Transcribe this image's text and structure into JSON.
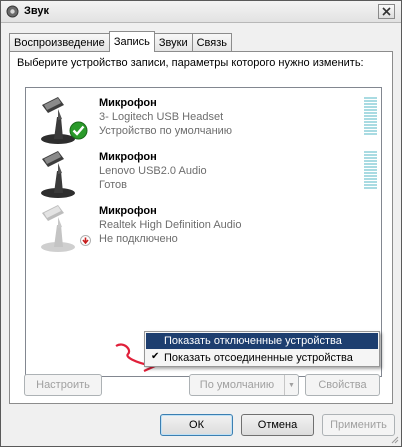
{
  "window": {
    "title": "Звук"
  },
  "tabs": [
    {
      "label": "Воспроизведение",
      "active": false
    },
    {
      "label": "Запись",
      "active": true
    },
    {
      "label": "Звуки",
      "active": false
    },
    {
      "label": "Связь",
      "active": false
    }
  ],
  "instruction": "Выберите устройство записи, параметры которого нужно изменить:",
  "devices": [
    {
      "name": "Микрофон",
      "description": "3- Logitech USB Headset",
      "status": "Устройство по умолчанию",
      "badge": "green-check-icon"
    },
    {
      "name": "Микрофон",
      "description": "Lenovo USB2.0 Audio",
      "status": "Готов",
      "badge": ""
    },
    {
      "name": "Микрофон",
      "description": "Realtek High Definition Audio",
      "status": "Не подключено",
      "badge": "red-down-arrow-icon"
    }
  ],
  "context_menu": {
    "items": [
      {
        "label": "Показать отключенные устройства",
        "checked": false,
        "highlighted": true
      },
      {
        "label": "Показать отсоединенные устройства",
        "checked": true,
        "highlighted": false
      }
    ]
  },
  "panel_buttons": {
    "configure": "Настроить",
    "set_default": "По умолчанию",
    "properties": "Свойства"
  },
  "dialog_buttons": {
    "ok": "ОК",
    "cancel": "Отмена",
    "apply": "Применить"
  },
  "colors": {
    "menu_highlight": "#1d3e6f",
    "level_meter": "#a9dbe2",
    "default_check": "#2a9a2a",
    "annotation_arrow": "#e0203a"
  }
}
